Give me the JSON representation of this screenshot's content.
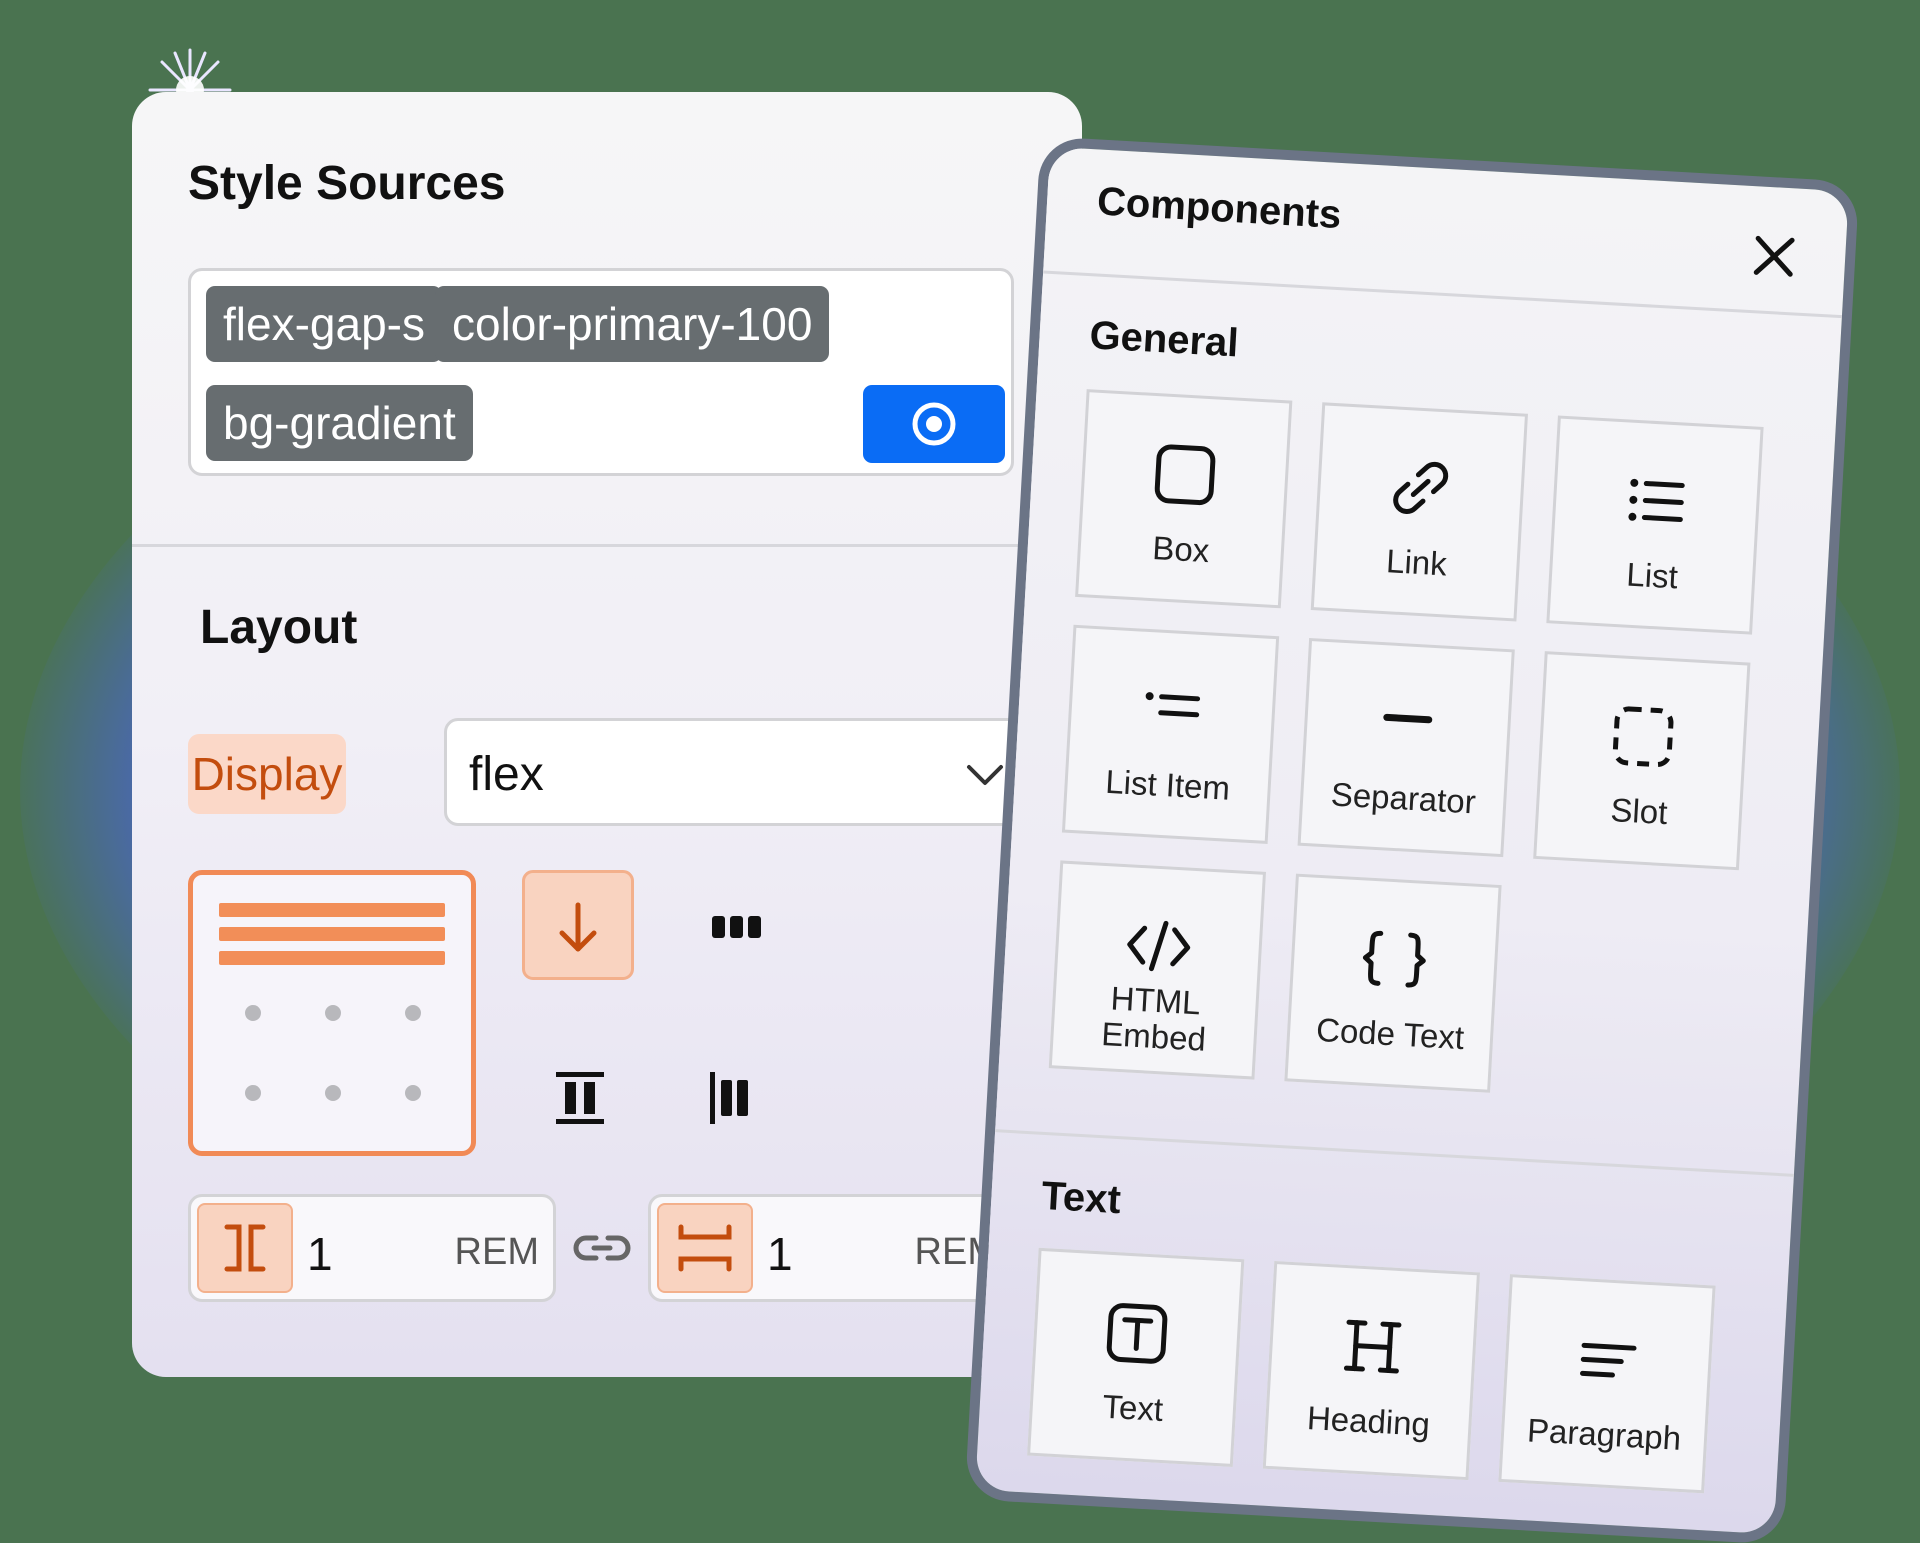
{
  "style_panel": {
    "title": "Style Sources",
    "tags": [
      "flex-gap-s",
      "color-primary-100",
      "bg-gradient"
    ],
    "layout_title": "Layout",
    "display_label": "Display",
    "display_value": "flex",
    "gap_column": {
      "value": "1",
      "unit": "REM"
    },
    "gap_row": {
      "value": "1",
      "unit": "REM"
    }
  },
  "components_panel": {
    "title": "Components",
    "sections": [
      {
        "title": "General",
        "items": [
          {
            "label": "Box",
            "icon": "box-icon"
          },
          {
            "label": "Link",
            "icon": "link-icon"
          },
          {
            "label": "List",
            "icon": "list-icon"
          },
          {
            "label": "List Item",
            "icon": "list-item-icon"
          },
          {
            "label": "Separator",
            "icon": "separator-icon"
          },
          {
            "label": "Slot",
            "icon": "slot-icon"
          },
          {
            "label": "HTML Embed",
            "icon": "code-embed-icon"
          },
          {
            "label": "Code Text",
            "icon": "braces-icon"
          }
        ]
      },
      {
        "title": "Text",
        "items": [
          {
            "label": "Text",
            "icon": "text-icon"
          },
          {
            "label": "Heading",
            "icon": "heading-icon"
          },
          {
            "label": "Paragraph",
            "icon": "paragraph-icon"
          }
        ]
      }
    ]
  },
  "colors": {
    "accent_blue": "#0a6cf5",
    "accent_orange": "#f28e58",
    "tag_gray": "#676d70"
  }
}
